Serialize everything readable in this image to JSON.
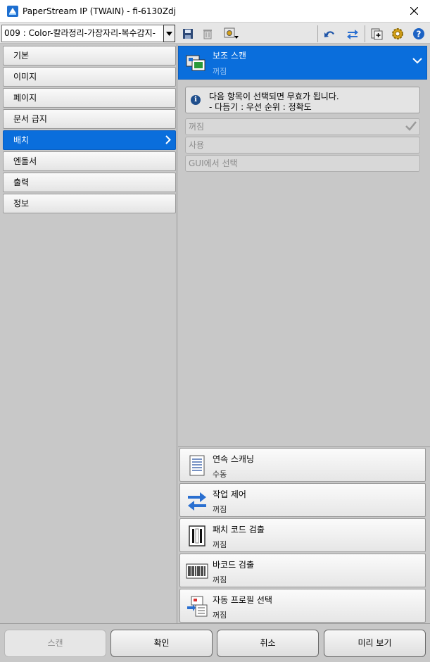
{
  "window": {
    "title": "PaperStream IP (TWAIN) - fi-6130Zdj"
  },
  "toolbar": {
    "profile": "009 : Color-칼라정리-가장자리-복수감지-",
    "icons": [
      "save-icon",
      "delete-icon",
      "profile-manage-icon",
      "undo-icon",
      "swap-icon",
      "add-profile-icon",
      "gear-icon",
      "help-icon"
    ]
  },
  "sidebar": {
    "items": [
      {
        "label": "기본"
      },
      {
        "label": "이미지"
      },
      {
        "label": "페이지"
      },
      {
        "label": "문서 급지"
      },
      {
        "label": "배치",
        "active": true
      },
      {
        "label": "엔돌서"
      },
      {
        "label": "출력"
      },
      {
        "label": "정보"
      }
    ]
  },
  "panel": {
    "title": "보조 스캔",
    "value": "꺼짐",
    "info_line1": "다음 항목이 선택되면 무효가 됩니다.",
    "info_line2": "- 다듬기 : 우선 순위 : 정확도",
    "options": [
      {
        "label": "꺼짐",
        "selected": true
      },
      {
        "label": "사용",
        "selected": false
      },
      {
        "label": "GUI에서 선택",
        "selected": false
      }
    ]
  },
  "features": [
    {
      "title": "연속 스캐닝",
      "value": "수동",
      "icon": "continuous-scan-icon"
    },
    {
      "title": "작업 제어",
      "value": "꺼짐",
      "icon": "job-control-icon"
    },
    {
      "title": "패치 코드 검출",
      "value": "꺼짐",
      "icon": "patch-code-icon"
    },
    {
      "title": "바코드 검출",
      "value": "꺼짐",
      "icon": "barcode-icon"
    },
    {
      "title": "자동 프로필 선택",
      "value": "꺼짐",
      "icon": "auto-profile-icon"
    }
  ],
  "footer": {
    "scan": "스캔",
    "ok": "확인",
    "cancel": "취소",
    "preview": "미리 보기"
  },
  "colors": {
    "accent": "#0a6edc",
    "panel_bg": "#c8c8c8"
  }
}
